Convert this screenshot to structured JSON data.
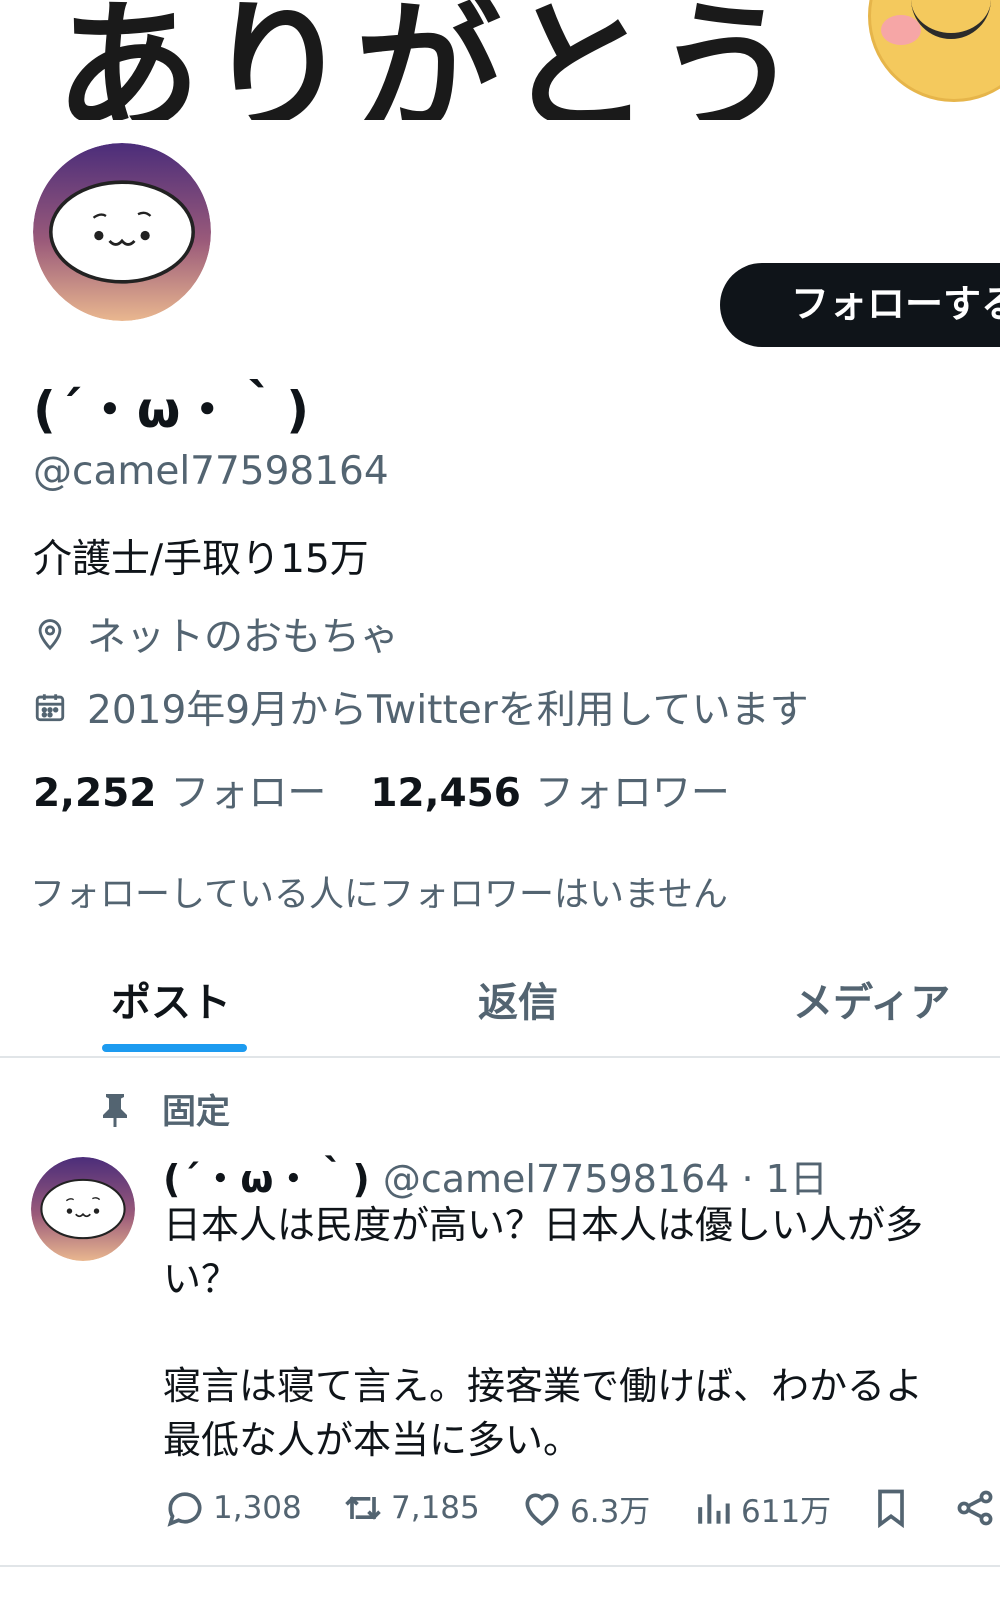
{
  "banner": {
    "text": "ありがとう"
  },
  "profile": {
    "display_name": "(´・ω・｀)",
    "handle": "@camel77598164",
    "bio": "介護士/手取り15万",
    "location": "ネットのおもちゃ",
    "joined": "2019年9月からTwitterを利用しています",
    "follow_button": "フォローする",
    "following_count": "2,252",
    "following_label": "フォロー",
    "followers_count": "12,456",
    "followers_label": "フォロワー",
    "mutual_note": "フォローしている人にフォロワーはいません"
  },
  "tabs": [
    {
      "label": "ポスト",
      "active": true
    },
    {
      "label": "返信",
      "active": false
    },
    {
      "label": "メディア",
      "active": false
    }
  ],
  "post": {
    "pinned_label": "固定",
    "author_name": "(´・ω・｀)",
    "author_meta": "@camel77598164 · 1日",
    "text_line_1": "日本人は民度が高い？日本人は優しい人が多",
    "text_line_2": "い？",
    "text_line_3": "寝言は寝て言え。接客業で働けば、わかるよ",
    "text_line_4": "最低な人が本当に多い。",
    "replies": "1,308",
    "reposts": "7,185",
    "likes": "6.3万",
    "views": "611万"
  },
  "colors": {
    "accent": "#1d9bf0",
    "text_primary": "#0f1419",
    "text_secondary": "#536471",
    "avatar_top": "#4b2d7a",
    "avatar_bottom": "#e9b78f"
  },
  "icons": {
    "location": "location-pin-icon",
    "calendar": "calendar-icon",
    "pin": "pin-icon",
    "reply": "reply-icon",
    "repost": "repost-icon",
    "like": "heart-icon",
    "views": "views-icon",
    "bookmark": "bookmark-icon",
    "share": "share-icon"
  }
}
